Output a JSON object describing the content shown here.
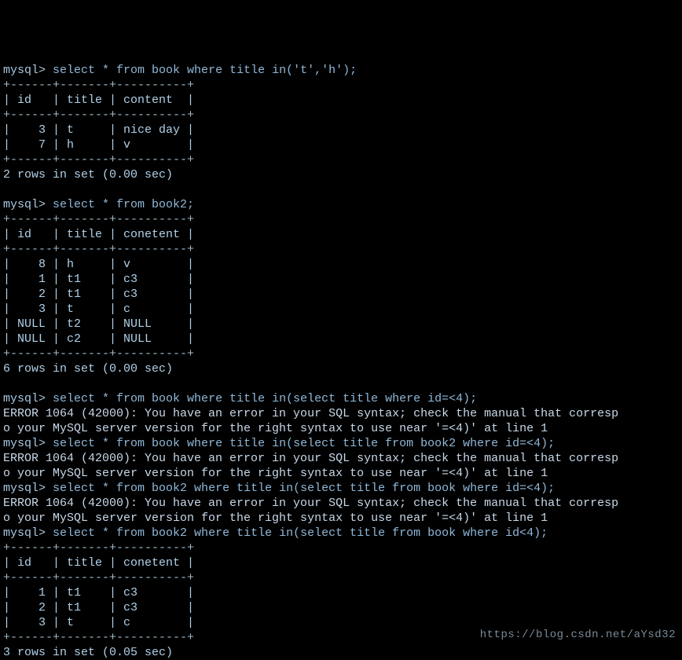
{
  "prompt": "mysql>",
  "queries": {
    "q1": "select * from book where title in('t','h');",
    "q2": "select * from book2;",
    "q3": "select * from book where title in(select title where id=<4);",
    "q4": "select * from book where title in(select title from book2 where id=<4);",
    "q5": "select * from book2 where title in(select title from book where id=<4);",
    "q6": "select * from book2 where title in(select title from book where id<4);"
  },
  "tables": {
    "book": {
      "sep": "+------+-------+----------+",
      "head": "| id   | title | content  |",
      "rows": [
        "|    3 | t     | nice day |",
        "|    7 | h     | v        |"
      ]
    },
    "book2": {
      "sep": "+------+-------+----------+",
      "head": "| id   | title | conetent |",
      "rows": [
        "|    8 | h     | v        |",
        "|    1 | t1    | c3       |",
        "|    2 | t1    | c3       |",
        "|    3 | t     | c        |",
        "| NULL | t2    | NULL     |",
        "| NULL | c2    | NULL     |"
      ]
    },
    "book2filtered": {
      "sep": "+------+-------+----------+",
      "head": "| id   | title | conetent |",
      "rows": [
        "|    1 | t1    | c3       |",
        "|    2 | t1    | c3       |",
        "|    3 | t     | c        |"
      ]
    }
  },
  "status": {
    "r2": "2 rows in set (0.00 sec)",
    "r6": "6 rows in set (0.00 sec)",
    "r3": "3 rows in set (0.05 sec)"
  },
  "errors": {
    "l1": "ERROR 1064 (42000): You have an error in your SQL syntax; check the manual that corresp",
    "l2": "o your MySQL server version for the right syntax to use near '=<4)' at line 1"
  },
  "watermark": "https://blog.csdn.net/aYsd32"
}
